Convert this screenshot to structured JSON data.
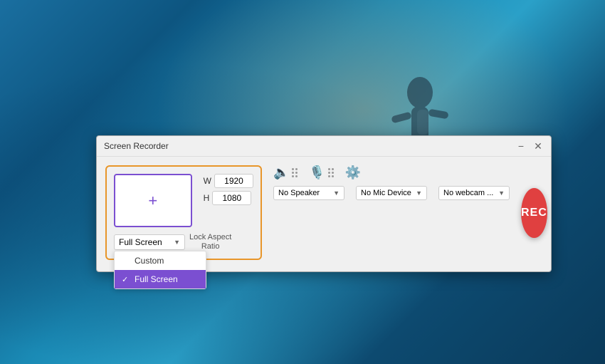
{
  "app": {
    "title": "Screen Recorder",
    "minimize_label": "−",
    "close_label": "✕"
  },
  "preview": {
    "plus": "+",
    "width_label": "W",
    "height_label": "H",
    "width_value": "1920",
    "height_value": "1080"
  },
  "mode": {
    "selected": "Full Screen",
    "options": [
      "Custom",
      "Full Screen"
    ]
  },
  "lock_aspect": "Lock Aspect\nRatio",
  "devices": {
    "speaker_label": "No Speaker",
    "mic_label": "No Mic Device",
    "webcam_label": "No webcam ..."
  },
  "rec_button_label": "REC",
  "colors": {
    "rec_bg": "#e04040",
    "accent_orange": "#e8962a",
    "accent_purple": "#7b4fd1",
    "dropdown_selected": "#7b4fd1"
  }
}
